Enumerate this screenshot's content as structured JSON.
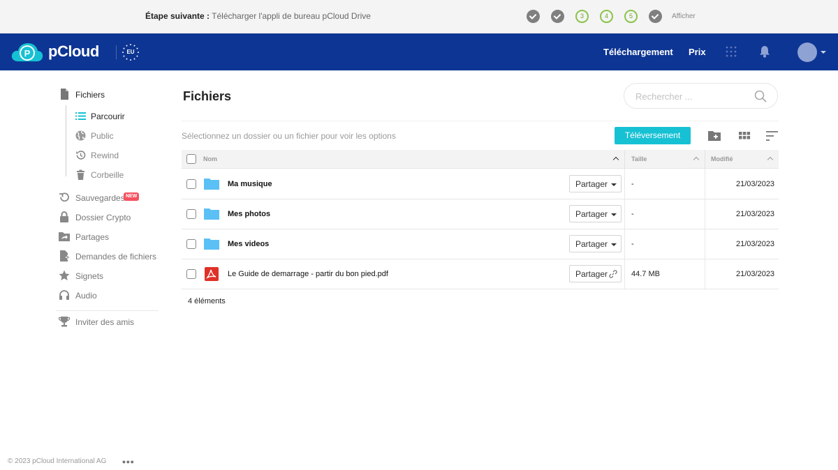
{
  "onboarding": {
    "next_label": "Étape suivante :",
    "next_text": "Télécharger l'appli de bureau pCloud Drive",
    "steps": [
      {
        "label": "",
        "done": true
      },
      {
        "label": "",
        "done": true
      },
      {
        "label": "3",
        "done": false
      },
      {
        "label": "4",
        "done": false
      },
      {
        "label": "5",
        "done": false
      },
      {
        "label": "",
        "done": true
      }
    ],
    "show_label": "Afficher"
  },
  "header": {
    "logo_text": "pCloud",
    "region_badge": "EU",
    "nav": [
      "Téléchargement",
      "Prix"
    ]
  },
  "sidebar": {
    "files": "Fichiers",
    "sub": [
      "Parcourir",
      "Public",
      "Rewind",
      "Corbeille"
    ],
    "items": [
      {
        "label": "Sauvegardes",
        "badge": "NEW"
      },
      {
        "label": "Dossier Crypto"
      },
      {
        "label": "Partages"
      },
      {
        "label": "Demandes de fichiers"
      },
      {
        "label": "Signets"
      },
      {
        "label": "Audio"
      }
    ],
    "invite": "Inviter des amis"
  },
  "main": {
    "title": "Fichiers",
    "search_placeholder": "Rechercher ...",
    "hint": "Sélectionnez un dossier ou un fichier pour voir les options",
    "upload_label": "Téléversement",
    "columns": {
      "name": "Nom",
      "size": "Taille",
      "modified": "Modifié"
    },
    "rows": [
      {
        "name": "Ma musique",
        "type": "folder",
        "share": "Partager",
        "size": "-",
        "modified": "21/03/2023"
      },
      {
        "name": "Mes photos",
        "type": "folder",
        "share": "Partager",
        "size": "-",
        "modified": "21/03/2023"
      },
      {
        "name": "Mes videos",
        "type": "folder",
        "share": "Partager",
        "size": "-",
        "modified": "21/03/2023"
      },
      {
        "name": "Le Guide de demarrage - partir du bon pied.pdf",
        "type": "pdf",
        "share": "Partager",
        "size": "44.7 MB",
        "modified": "21/03/2023"
      }
    ],
    "count": "4 éléments"
  },
  "footer": {
    "copyright": "© 2023 pCloud International AG",
    "more": "•••"
  },
  "colors": {
    "header_bg": "#0d3593",
    "accent": "#17c1d4",
    "step_pending": "#8bc34a",
    "folder": "#5bc0f5",
    "pdf": "#e03128",
    "new_badge": "#f5515f"
  }
}
